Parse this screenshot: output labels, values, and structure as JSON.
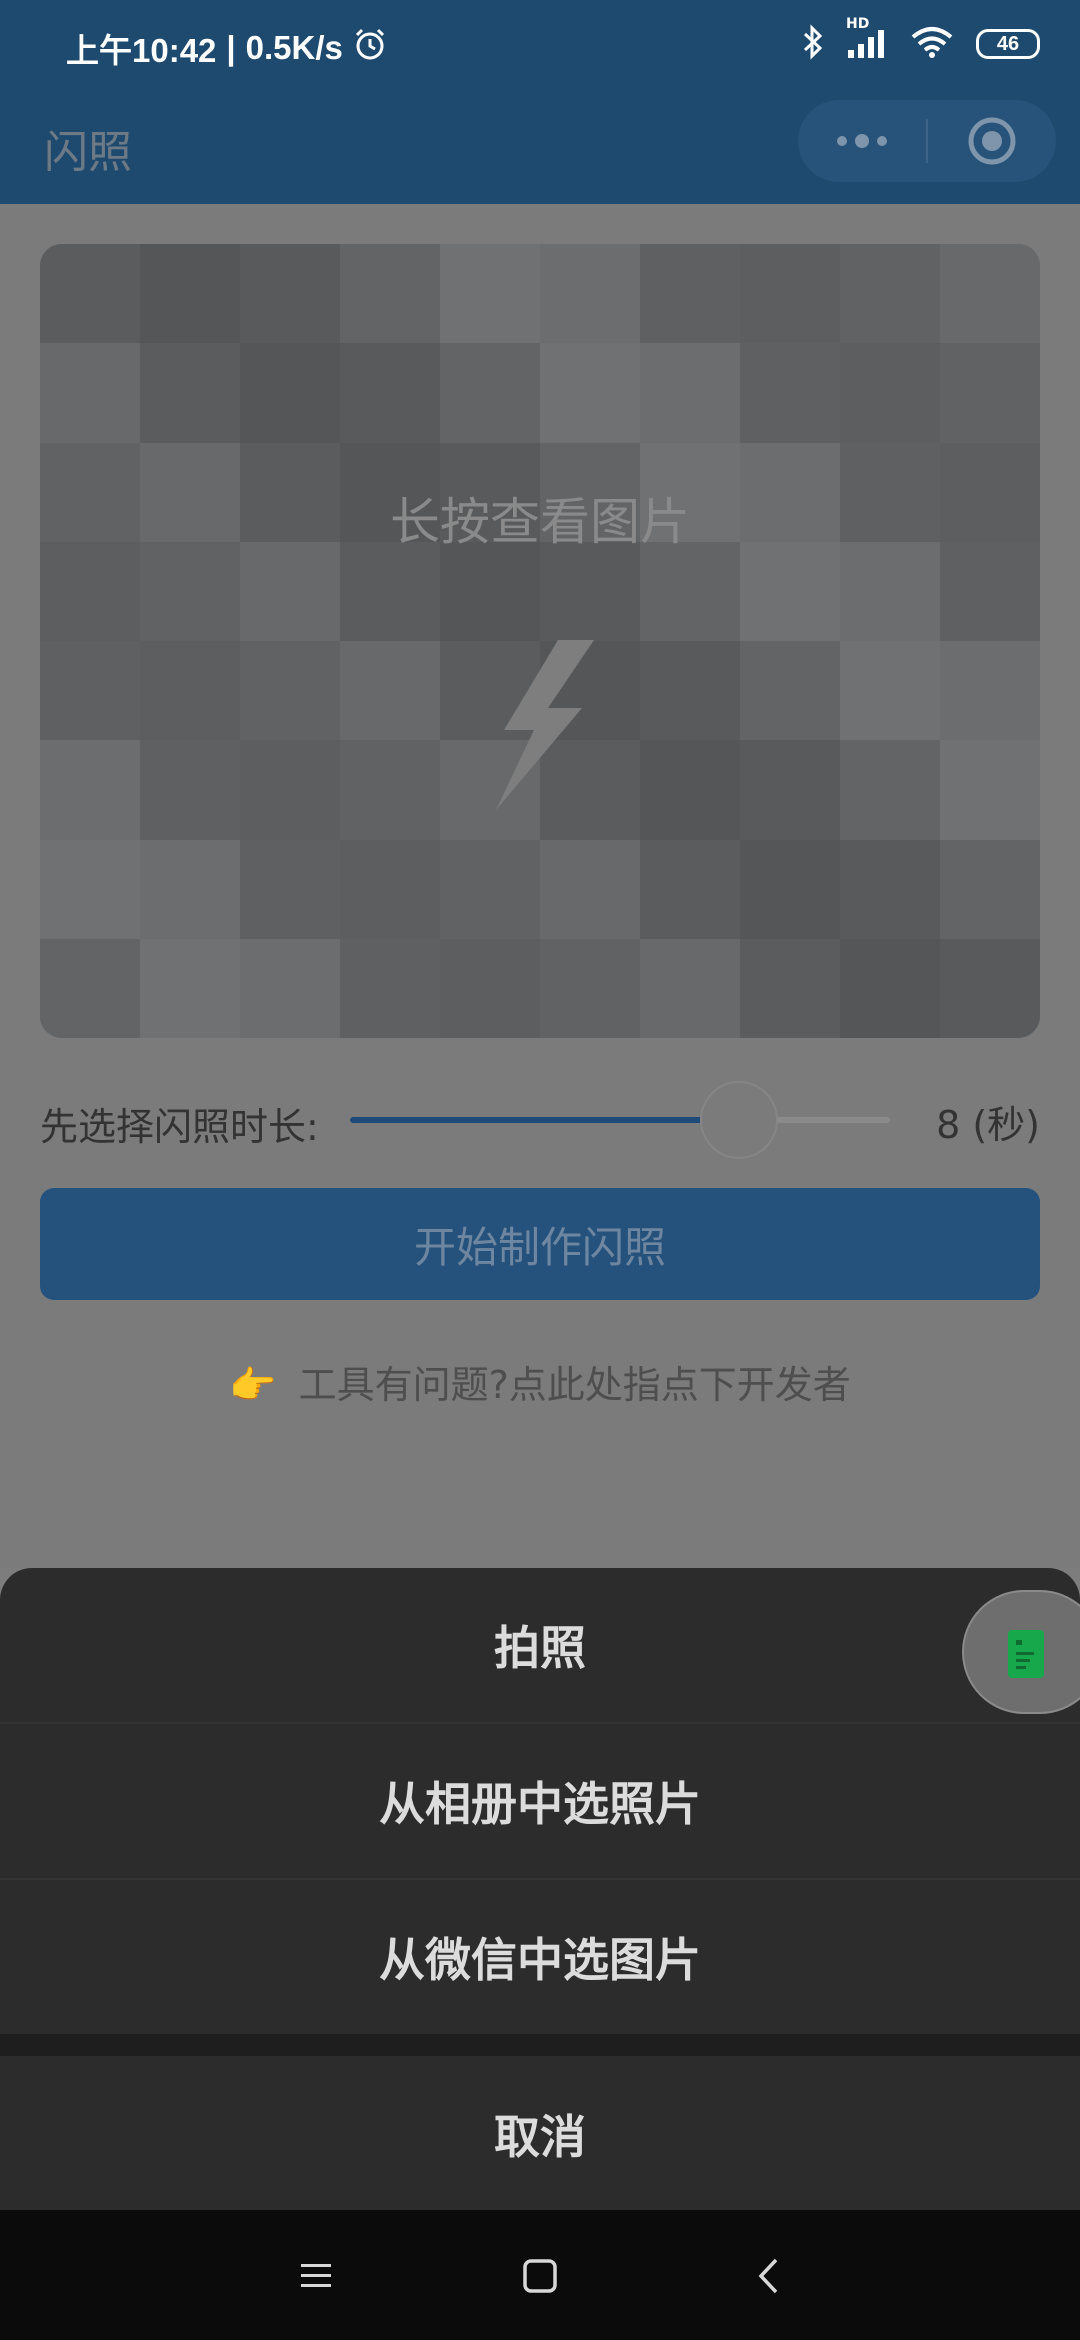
{
  "status": {
    "time": "上午10:42",
    "separator": "|",
    "speed": "0.5K/s",
    "battery": "46",
    "signal_label": "HD"
  },
  "nav": {
    "title": "闪照"
  },
  "photo": {
    "hint": "长按查看图片"
  },
  "duration": {
    "label": "先选择闪照时长:",
    "value": "8",
    "unit": "(秒)",
    "slider_fraction": 0.72
  },
  "start_button": "开始制作闪照",
  "feedback": {
    "emoji": "👉",
    "text": "工具有问题?点此处指点下开发者"
  },
  "action_sheet": {
    "items": [
      "拍照",
      "从相册中选照片",
      "从微信中选图片"
    ],
    "cancel": "取消"
  },
  "colors": {
    "accent": "#1f4a6f",
    "sheet_bg": "#2c2c2c",
    "float_icon": "#18a84c"
  }
}
